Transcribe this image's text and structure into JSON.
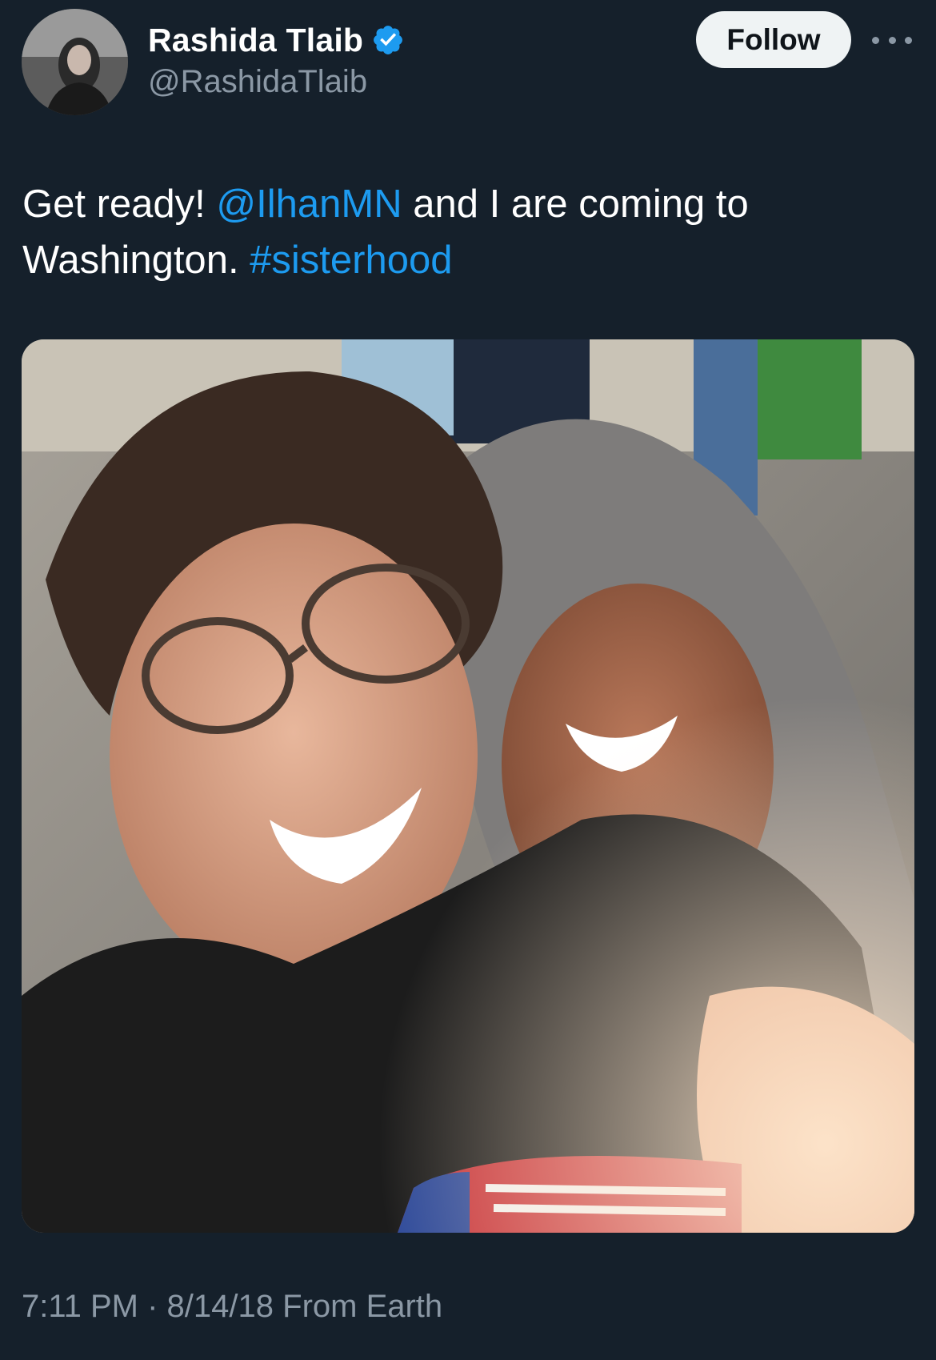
{
  "author": {
    "display_name": "Rashida Tlaib",
    "handle": "@RashidaTlaib",
    "verified": true
  },
  "actions": {
    "follow_label": "Follow"
  },
  "tweet": {
    "text_prefix": "Get ready! ",
    "mention": "@IlhanMN",
    "text_middle": " and I are coming to Washington. ",
    "hashtag": "#sisterhood"
  },
  "meta": {
    "time": "7:11 PM",
    "separator": " · ",
    "date": "8/14/18",
    "source": " From Earth"
  },
  "colors": {
    "background": "#15202b",
    "link": "#1d9bf0",
    "secondary_text": "#8b98a5",
    "verified_badge": "#1d9bf0",
    "follow_button_bg": "#eff3f4"
  },
  "icons": {
    "verified": "verified-badge-icon",
    "more": "more-horizontal-icon"
  }
}
